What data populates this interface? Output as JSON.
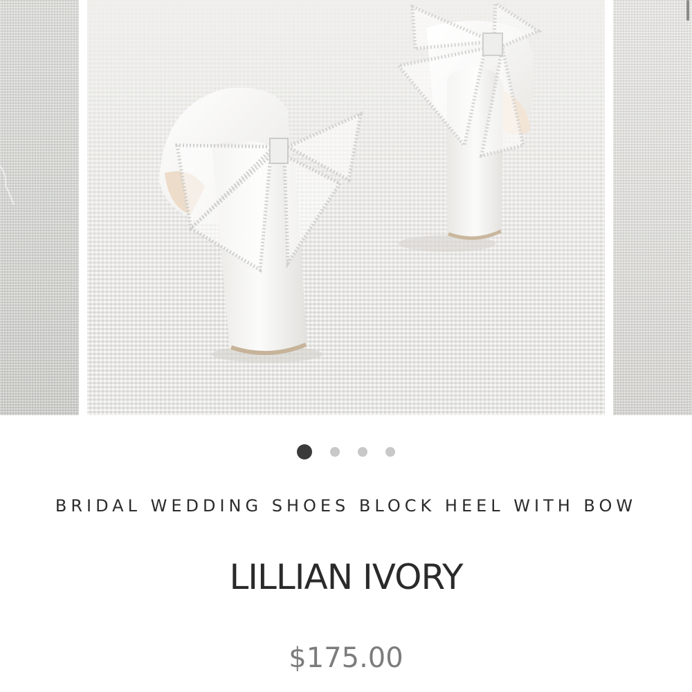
{
  "gallery": {
    "slides": [
      {
        "name": "previous-slide"
      },
      {
        "name": "current-slide",
        "alt": "Ivory block heel shoes with crystal bow"
      },
      {
        "name": "next-slide"
      }
    ],
    "dot_count": 4,
    "active_index": 0
  },
  "product": {
    "subtitle": "BRIDAL WEDDING SHOES BLOCK HEEL WITH BOW",
    "title": "LILLIAN IVORY",
    "price": "$175.00"
  },
  "colors": {
    "text_primary": "#2a2a2a",
    "text_price": "#7c7c7c",
    "dot_active": "#3a3a3a",
    "dot_inactive": "#c8c8c8"
  }
}
